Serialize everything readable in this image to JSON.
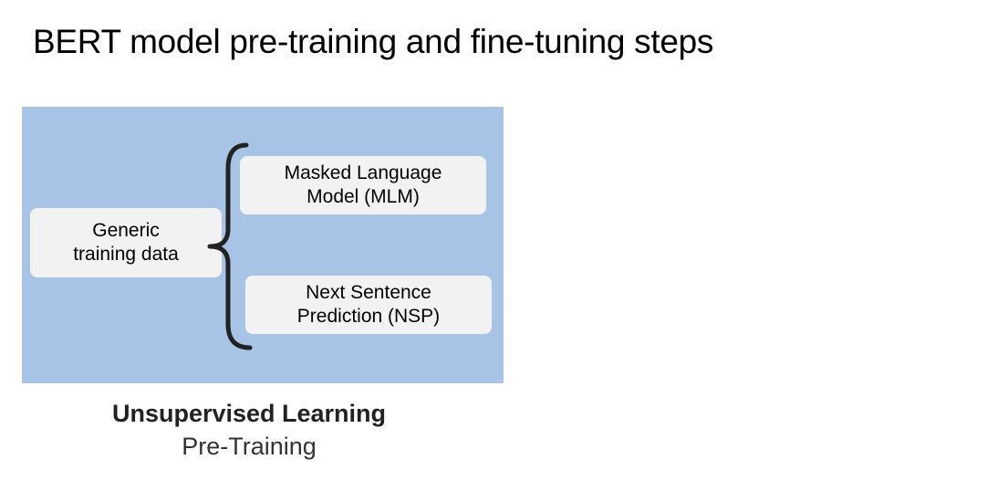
{
  "title": "BERT model pre-training and fine-tuning steps",
  "diagram": {
    "panel_color": "#a7c4e7",
    "box_color": "#f2f2f2",
    "brace_color": "#222222",
    "input_box": {
      "line1": "Generic",
      "line2": "training data"
    },
    "tasks": [
      {
        "line1": "Masked Language",
        "line2": "Model (MLM)"
      },
      {
        "line1": "Next Sentence",
        "line2": "Prediction (NSP)"
      }
    ]
  },
  "caption": {
    "heading": "Unsupervised Learning",
    "subheading": "Pre-Training"
  }
}
